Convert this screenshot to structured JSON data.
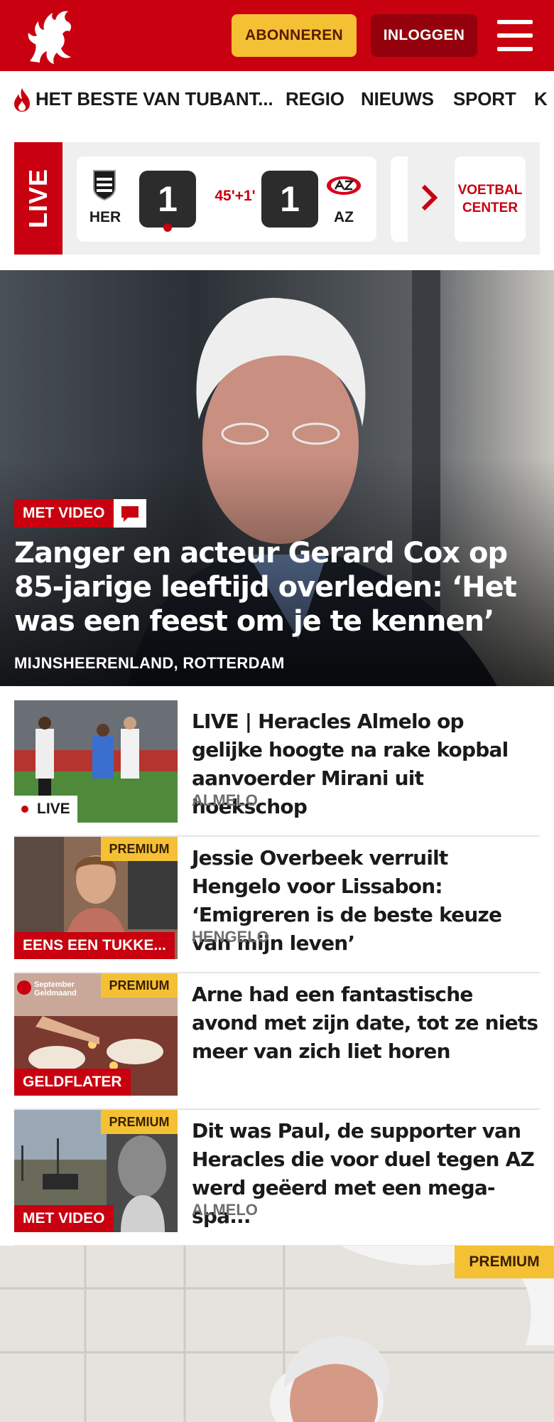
{
  "header": {
    "subscribe_label": "ABONNEREN",
    "login_label": "INLOGGEN",
    "brand_color": "#c8000f",
    "logo_icon": "twente-horse-logo",
    "menu_icon": "hamburger-menu-icon"
  },
  "nav": {
    "items": [
      {
        "label": "HET BESTE VAN TUBANT..."
      },
      {
        "label": "REGIO"
      },
      {
        "label": "NIEUWS"
      },
      {
        "label": "SPORT"
      },
      {
        "label": "K"
      }
    ]
  },
  "live": {
    "tag": "LIVE",
    "home_code": "HER",
    "home_score": "1",
    "time": "45'+1'",
    "away_score": "1",
    "away_code": "AZ",
    "voetbal_center_line1": "VOETBAL",
    "voetbal_center_line2": "CENTER"
  },
  "hero": {
    "badge": "MET VIDEO",
    "title": "Zanger en acteur Gerard Cox op 85-jarige leeftijd overleden: ‘Het was een feest om je te kennen’",
    "location": "MIJNSHEERENLAND, ROTTERDAM"
  },
  "articles": [
    {
      "badge": "LIVE",
      "title": "LIVE | Heracles Almelo op gelijke hoogte na rake kopbal aanvoerder Mirani uit hoekschop",
      "location": "ALMELO"
    },
    {
      "premium": "PREMIUM",
      "badge": "EENS EEN TUKKE...",
      "title": "Jessie Overbeek verruilt Hengelo voor Lissabon: ‘Emigreren is de beste keuze van mijn leven’",
      "location": "HENGELO"
    },
    {
      "premium": "PREMIUM",
      "badge": "GELDFLATER",
      "title": "Arne had een fantastische avond met zijn date, tot ze niets meer van zich liet horen",
      "location": ""
    },
    {
      "premium": "PREMIUM",
      "badge": "MET VIDEO",
      "title": "Dit was Paul, de supporter van Heracles die voor duel tegen AZ werd geëerd met een mega-spa...",
      "location": "ALMELO"
    }
  ],
  "thumb_text": {
    "geldmaand_line1": "September",
    "geldmaand_line2": "Geldmaand"
  },
  "feature": {
    "premium": "PREMIUM"
  }
}
